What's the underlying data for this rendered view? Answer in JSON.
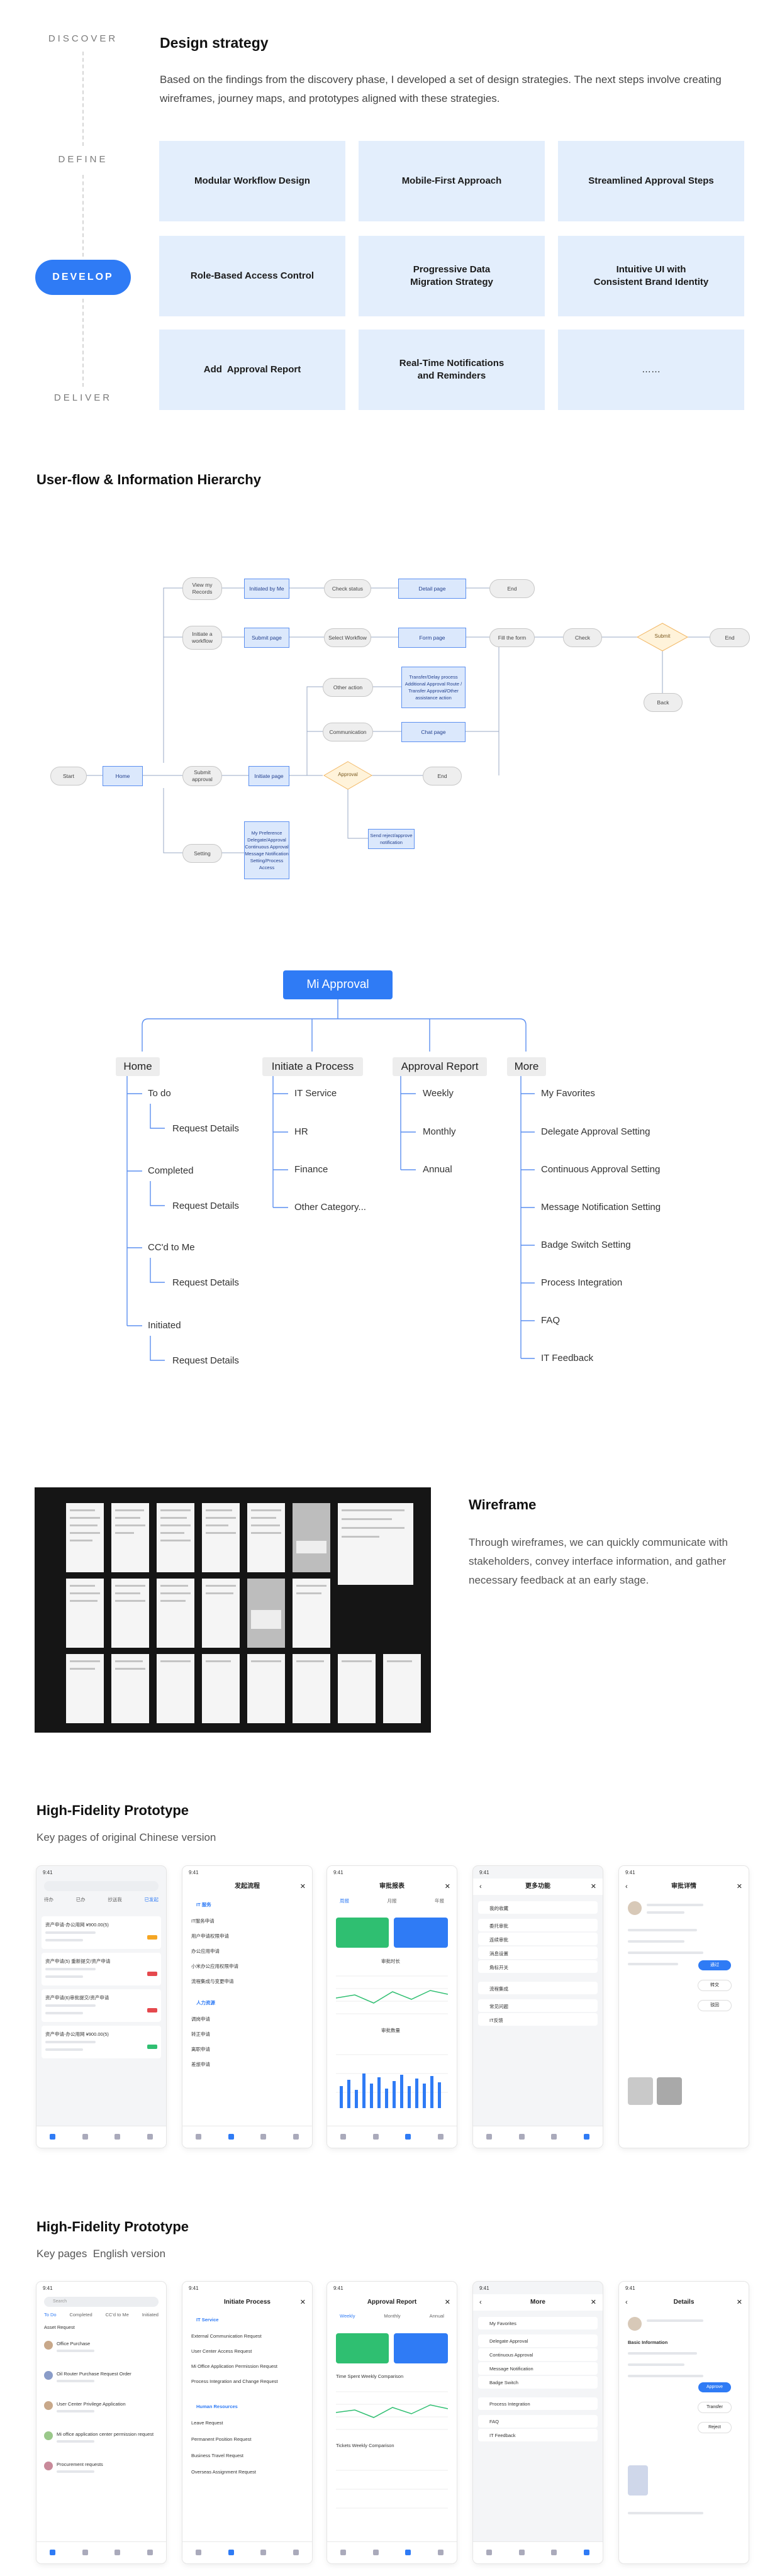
{
  "strategy": {
    "phases": [
      "DISCOVER",
      "DEFINE",
      "DEVELOP",
      "DELIVER"
    ],
    "title": "Design strategy",
    "description": "Based on the findings from the discovery phase, I developed a set of design strategies. The next steps involve creating wireframes, journey maps, and prototypes aligned with these strategies.",
    "cards": [
      "Modular Workflow Design",
      "Mobile-First Approach",
      "Streamlined Approval Steps",
      "Role-Based Access Control",
      "Progressive Data\nMigration Strategy",
      "Intuitive UI with\nConsistent Brand Identity",
      "Add  Approval Report",
      "Real-Time Notifications\nand Reminders",
      "……"
    ]
  },
  "flow": {
    "title": "User-flow & Information Hierarchy",
    "nodes": {
      "start": "Start",
      "home": "Home",
      "submit_approval": "Submit approval",
      "initiate_page": "Initiate page",
      "approval_diamond": "Approval",
      "end_mid": "End",
      "view_records": "View my Records",
      "initiated_by_me": "Initiated by Me",
      "check_status": "Check status",
      "detail_page": "Detail page",
      "end_top": "End",
      "initiate_workflow": "Initiate a workflow",
      "submit_page": "Submit page",
      "select_workflow": "Select Workflow",
      "form_page": "Form page",
      "fill_form": "Fill the form",
      "check": "Check",
      "submit_diamond": "Submit",
      "end_right": "End",
      "back": "Back",
      "other_action": "Other action",
      "transfer_box": "Transfer/Delay process\nAdditional Approval Route /\nTransfer Approval/Other\nassistance action",
      "communication": "Communication",
      "chat_page": "Chat page",
      "setting": "Setting",
      "settings_box": "My Preference\nDelegate/Approval\nContinuous Approval\nMessage Notification\nSetting/Process\nAccess",
      "send_notification": "Send reject/approve\nnotification"
    }
  },
  "hierarchy": {
    "root": "Mi Approval",
    "categories": [
      {
        "name": "Home",
        "items": [
          "To do",
          "Request Details",
          "Completed",
          "Request Details",
          "CC'd to Me",
          "Request Details",
          "Initiated",
          "Request Details"
        ]
      },
      {
        "name": "Initiate a Process",
        "items": [
          "IT Service",
          "HR",
          "Finance",
          "Other Category..."
        ]
      },
      {
        "name": "Approval Report",
        "items": [
          "Weekly",
          "Monthly",
          "Annual"
        ]
      },
      {
        "name": "More",
        "items": [
          "My Favorites",
          "Delegate Approval Setting",
          "Continuous Approval Setting",
          "Message Notification Setting",
          "Badge Switch Setting",
          "Process Integration",
          "FAQ",
          "IT Feedback"
        ]
      }
    ]
  },
  "wireframe": {
    "title": "Wireframe",
    "description": "Through wireframes, we can quickly communicate with stakeholders, convey interface information, and gather necessary feedback at an early stage."
  },
  "hifi_cn": {
    "title": "High-Fidelity Prototype",
    "subtitle": "Key pages of original Chinese version",
    "screens": {
      "s1": {
        "tabs": [
          "待办",
          "已办",
          "抄送我",
          "已发起"
        ],
        "items": [
          "资产申请-办公用网 ¥900.00(5)",
          "资产申请(5) 重新提交/资产申请",
          "资产申请(6)审批提交/资产申请",
          "资产申请-办公用网 ¥900.00(5)"
        ]
      },
      "s2": {
        "title": "发起流程",
        "groups": [
          "IT 服务",
          "人力资源"
        ],
        "items": [
          "IT服务申请",
          "用户申请权限申请",
          "办公应用申请",
          "小米办公应用权限申请",
          "流程集成与变更申请",
          "调岗申请",
          "转正申请",
          "离职申请",
          "差旅申请"
        ]
      },
      "s3": {
        "title": "审批报表",
        "tabs": [
          "周报",
          "月报",
          "年报"
        ],
        "chart1": "审批时长",
        "chart2": "审批数量"
      },
      "s4": {
        "title": "更多功能",
        "items": [
          "我的收藏",
          "委托审批",
          "连续审批",
          "消息设置",
          "角标开关",
          "流程集成",
          "常见问题",
          "IT反馈"
        ]
      },
      "s5": {
        "title": "审批详情",
        "actions": [
          "通过",
          "转交",
          "驳回"
        ]
      }
    }
  },
  "hifi_en": {
    "title": "High-Fidelity Prototype",
    "subtitle": "Key pages  English version",
    "screens": {
      "s1": {
        "search": "Search",
        "tabs": [
          "To Do",
          "Completed",
          "CC'd to Me",
          "Initiated"
        ],
        "filter": "Asset Request",
        "items": [
          "Office Purchase",
          "Oil Router Purchase Request Order",
          "User Center Privilege Application",
          "Mi office application center permission request",
          "Procurement requests"
        ]
      },
      "s2": {
        "title": "Initiate Process",
        "groups": [
          "IT Service",
          "Human Resources"
        ],
        "items": [
          "External Communication Request",
          "User Center Access Request",
          "Mi Office Application Permission Request",
          "Process Integration and Change Request",
          "Leave Request",
          "Permanent Position Request",
          "Business Travel Request",
          "Overseas Assignment Request"
        ]
      },
      "s3": {
        "title": "Approval Report",
        "tabs": [
          "Weekly",
          "Monthly",
          "Annual"
        ],
        "chart1": "Time Spent Weekly Comparison",
        "chart2": "Tickets Weekly Comparison"
      },
      "s4": {
        "title": "More",
        "items": [
          "My Favorites",
          "Delegate Approval",
          "Continuous Approval",
          "Message Notification",
          "Badge Switch",
          "Process Integration",
          "FAQ",
          "IT Feedback"
        ]
      },
      "s5": {
        "title": "Details",
        "section": "Basic Information",
        "actions": [
          "Approve",
          "Transfer",
          "Reject"
        ]
      }
    }
  }
}
